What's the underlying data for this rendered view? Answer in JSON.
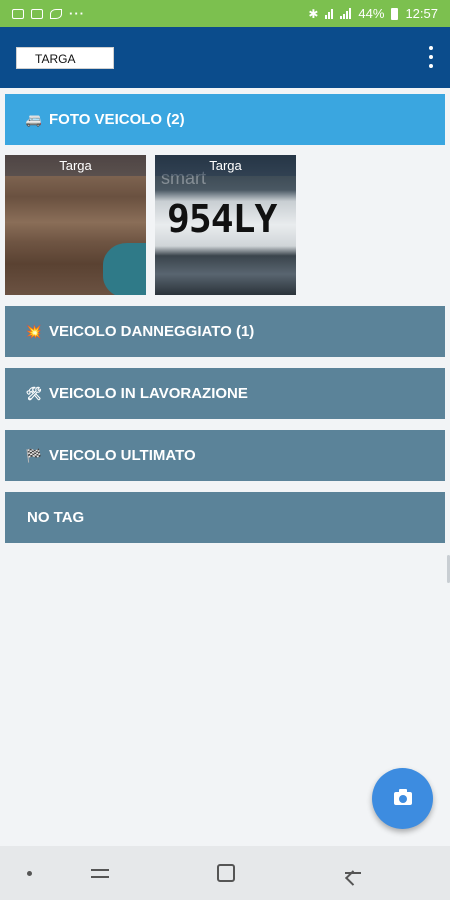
{
  "status_bar": {
    "time": "12:57",
    "battery": "44%",
    "more": "···",
    "bluetooth_glyph": "✱",
    "colors": {
      "background": "#7cc04f"
    }
  },
  "app_bar": {
    "plate_field_value": "TARGA",
    "menu_icon": "overflow-menu-icon",
    "colors": {
      "background": "#0b4c8c"
    }
  },
  "sections": {
    "photos": {
      "emoji": "🚐",
      "label": "FOTO VEICOLO (2)",
      "color": "#3aa6e0"
    },
    "damaged": {
      "emoji": "💥",
      "label": "VEICOLO DANNEGGIATO (1)",
      "color": "#5b8399"
    },
    "working": {
      "emoji": "🛠",
      "label": "VEICOLO IN LAVORAZIONE",
      "color": "#5b8399"
    },
    "done": {
      "emoji": "🏁",
      "label": "VEICOLO ULTIMATO",
      "color": "#5b8399"
    },
    "no_tag": {
      "label": "NO TAG",
      "color": "#5b8399"
    }
  },
  "photos": [
    {
      "caption": "Targa"
    },
    {
      "caption": "Targa",
      "plate_text": "954LY",
      "badge_text": "smart"
    }
  ],
  "fab": {
    "icon": "camera-icon",
    "color": "#3d8ce0"
  },
  "nav_bar": {
    "icons": [
      "dot-icon",
      "recents-icon",
      "home-icon",
      "back-icon"
    ]
  }
}
